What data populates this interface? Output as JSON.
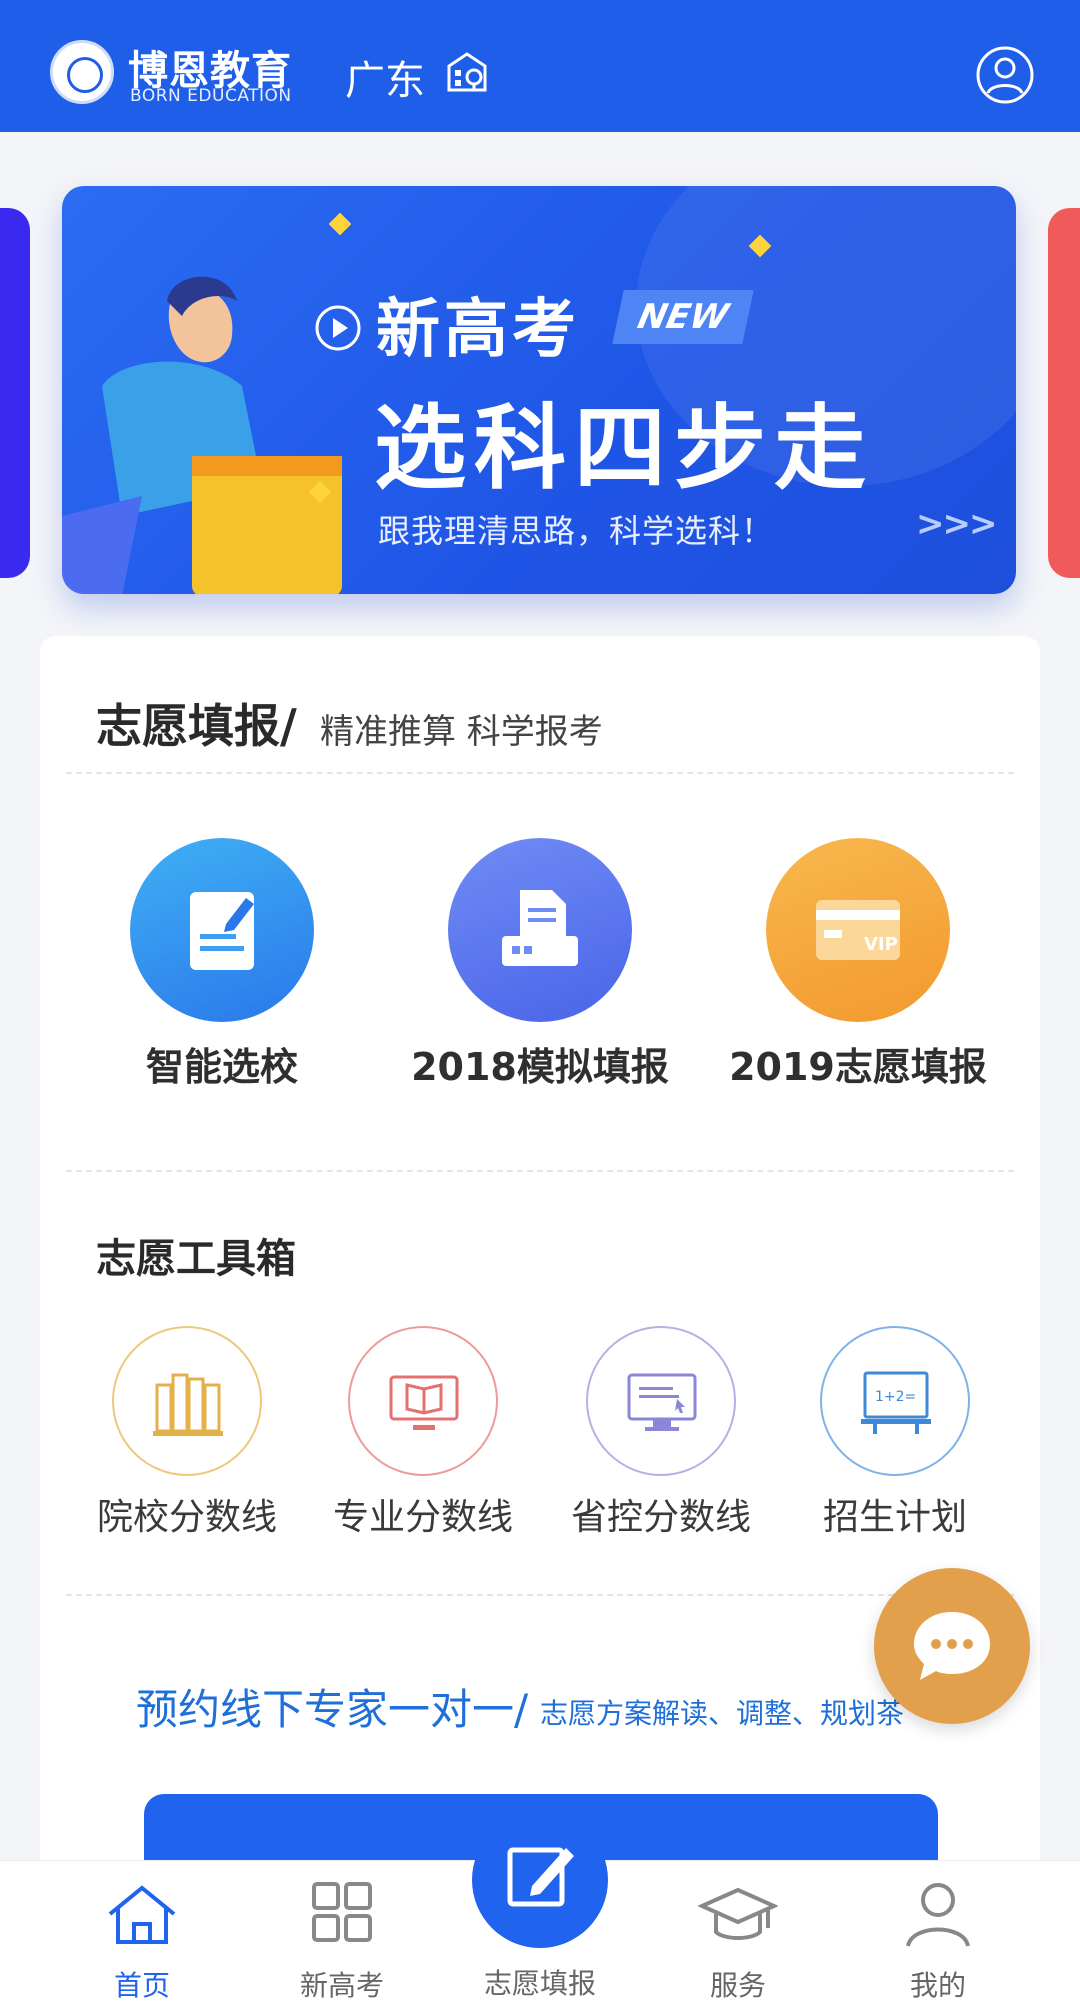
{
  "header": {
    "brand_cn": "博恩教育",
    "brand_en": "BORN EDUCATION",
    "region": "广东"
  },
  "banner": {
    "line1": "新高考",
    "badge": "NEW",
    "line2": "选科四步走",
    "line3": "跟我理清思路，科学选科！",
    "arrows": ">>>"
  },
  "volunteer": {
    "title": "志愿填报/",
    "subtitle": "精准推算 科学报考",
    "features": [
      {
        "label": "智能选校",
        "icon": "form-icon",
        "color": "#2f8ef0"
      },
      {
        "label": "2018模拟填报",
        "icon": "printer-icon",
        "color": "#5573ee"
      },
      {
        "label": "2019志愿填报",
        "icon": "vip-card-icon",
        "color": "#f3a742"
      }
    ]
  },
  "toolbox": {
    "title": "志愿工具箱",
    "items": [
      {
        "label": "院校分数线",
        "icon": "books-icon",
        "color": "#e4b04a"
      },
      {
        "label": "专业分数线",
        "icon": "book-monitor-icon",
        "color": "#e57070"
      },
      {
        "label": "省控分数线",
        "icon": "monitor-icon",
        "color": "#8a86d8"
      },
      {
        "label": "招生计划",
        "icon": "blackboard-icon",
        "color": "#3f8ad8"
      }
    ]
  },
  "appointment": {
    "title": "预约线下专家一对一/",
    "subtitle": "志愿方案解读、调整、规划茶"
  },
  "tabs": [
    {
      "label": "首页",
      "icon": "home-icon",
      "active": true
    },
    {
      "label": "新高考",
      "icon": "grid-icon",
      "active": false
    },
    {
      "label": "志愿填报",
      "icon": "edit-icon",
      "active": false
    },
    {
      "label": "服务",
      "icon": "graduation-cap-icon",
      "active": false
    },
    {
      "label": "我的",
      "icon": "profile-icon",
      "active": false
    }
  ],
  "colors": {
    "primary": "#1f5ee8",
    "chat": "#e2a04c"
  }
}
